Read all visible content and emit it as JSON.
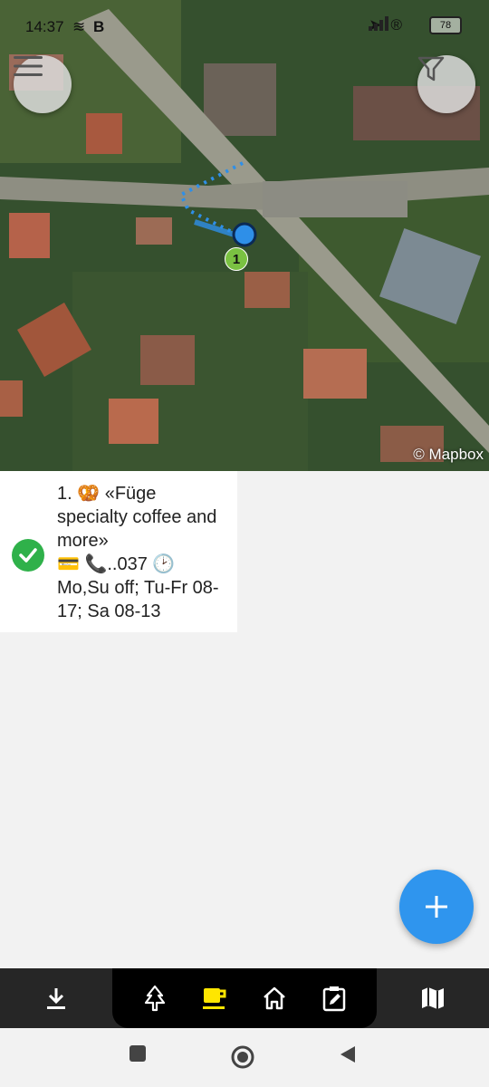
{
  "status_bar": {
    "time": "14:37",
    "battery_level": "78",
    "icons": [
      "stack-icon",
      "b-icon",
      "location-arrow-icon",
      "registered-icon",
      "signal-icon",
      "signal-4g-icon"
    ]
  },
  "map": {
    "attribution": "© Mapbox",
    "marker_label": "1",
    "colors": {
      "track": "#2e8fe8",
      "marker": "#7ac142"
    }
  },
  "poi": {
    "title_line": "1. 🥨 «Füge specialty coffee and more»",
    "info_line": "💳 📞..037 🕑 Mo,Su off; Tu-Fr 08-17; Sa 08-13",
    "status": "check-icon",
    "status_color": "#2fb14a"
  },
  "fab": {
    "icon": "plus-icon",
    "color": "#2f95ee"
  },
  "toolbar": {
    "items": [
      {
        "icon": "download-icon"
      },
      {
        "icon": "tree-icon"
      },
      {
        "icon": "coffee-cup-icon",
        "active": true
      },
      {
        "icon": "home-icon"
      },
      {
        "icon": "clipboard-edit-icon"
      },
      {
        "icon": "map-icon"
      }
    ],
    "active_color": "#ffe600"
  }
}
